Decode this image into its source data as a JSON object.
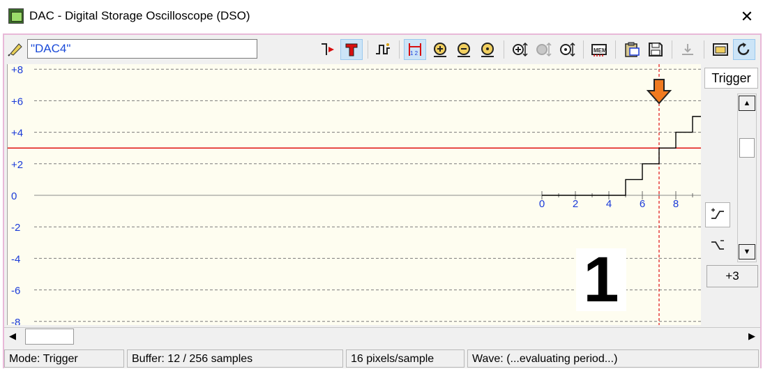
{
  "window": {
    "title": "DAC - Digital Storage Oscilloscope (DSO)",
    "close_glyph": "✕"
  },
  "toolbar": {
    "channel_name": "\"DAC4\""
  },
  "plot": {
    "y_tick_labels": [
      "+8",
      "+6",
      "+4",
      "+2",
      "0",
      "-2",
      "-4",
      "-6",
      "-8"
    ],
    "x_tick_labels": [
      "0",
      "2",
      "4",
      "6",
      "8"
    ],
    "trigger_level": 3,
    "trigger_sample": 7,
    "colors": {
      "background": "#fefdf0",
      "grid": "#7a7a7a",
      "trigger_line": "#e01010",
      "waveform": "#000000",
      "axis_labels": "#1a3ad8",
      "marker_arrow": "#f07a20"
    }
  },
  "chart_data": {
    "type": "line",
    "xlabel": "",
    "ylabel": "",
    "ylim": [
      -8,
      8
    ],
    "x": [
      0,
      1,
      2,
      3,
      4,
      5,
      6,
      7,
      8,
      9
    ],
    "values": [
      0,
      0,
      0,
      0,
      0,
      1,
      2,
      3,
      4,
      5
    ],
    "step": true
  },
  "side_panel": {
    "mode_label": "Trigger",
    "up_glyph": "▲",
    "down_glyph": "▼",
    "rising_slope_icon": "rising-edge-icon",
    "falling_slope_icon": "falling-edge-icon",
    "trigger_value": "+3"
  },
  "hscroll": {
    "left_glyph": "◀",
    "right_glyph": "▶"
  },
  "status": {
    "mode": "Mode: Trigger",
    "buffer": "Buffer:  12 / 256 samples",
    "scale": "16 pixels/sample",
    "wave": "Wave: (...evaluating period...)"
  },
  "overlay_label": "1"
}
